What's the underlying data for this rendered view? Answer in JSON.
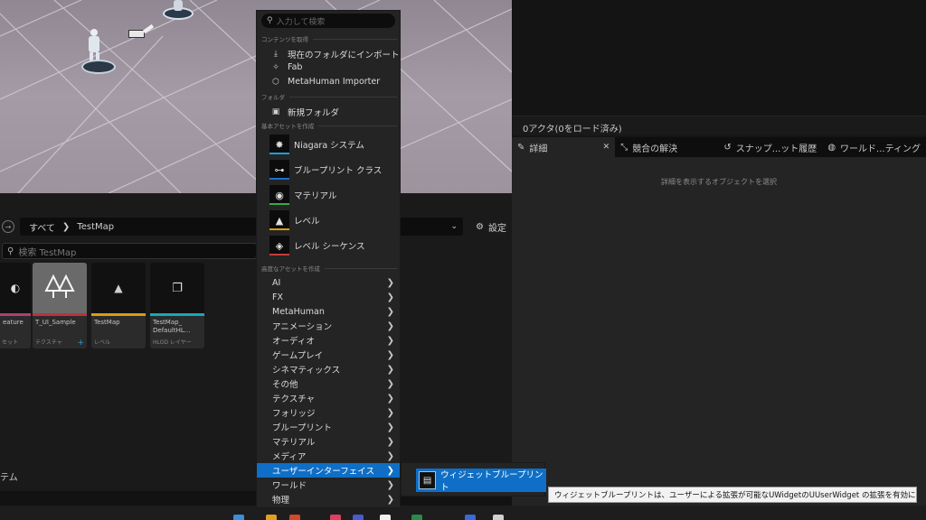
{
  "viewport": {},
  "right_panel": {
    "outliner_status": "0アクタ(0をロード済み)",
    "tabs": [
      {
        "label": "詳細",
        "icon": "pencil-icon",
        "closable": true
      },
      {
        "label": "競合の解決",
        "icon": "merge-icon"
      },
      {
        "label": "スナップ...ット履歴",
        "icon": "history-icon"
      },
      {
        "label": "ワールド...ティング",
        "icon": "globe-icon"
      }
    ],
    "close_glyph": "✕",
    "details_empty_text": "詳細を表示するオブジェクトを選択"
  },
  "content_browser": {
    "breadcrumb_root": "すべて",
    "breadcrumb_sep": "❯",
    "breadcrumb_current": "TestMap",
    "settings_label": "設定",
    "search_placeholder": "検索 TestMap",
    "assets": [
      {
        "name": "eature",
        "type": "セット",
        "color": "#b04070"
      },
      {
        "name": "T_UI_Sample",
        "type": "テクスチャ",
        "color": "#c0303c",
        "plus": "+"
      },
      {
        "name": "TestMap",
        "type": "レベル",
        "color": "#e09a10"
      },
      {
        "name": "TestMap_ DefaultHL...",
        "type": "HLOD レイヤー",
        "color": "#18a8b8"
      }
    ],
    "bottom_label": "テム"
  },
  "menu": {
    "search_placeholder": "入力して検索",
    "section_import": "コンテンツを取得",
    "import_items": [
      {
        "label": "現在のフォルダにインポート",
        "icon": "import-icon"
      },
      {
        "label": "Fab",
        "icon": "fab-icon"
      },
      {
        "label": "MetaHuman Importer",
        "icon": "cube-icon"
      }
    ],
    "section_folder": "フォルダ",
    "folder_items": [
      {
        "label": "新規フォルダ",
        "icon": "new-folder-icon"
      }
    ],
    "section_basic": "基本アセットを作成",
    "basic_assets": [
      {
        "label": "Niagara システム",
        "icon": "niagara-icon",
        "color": "#1aa0d8"
      },
      {
        "label": "ブループリント クラス",
        "icon": "blueprint-icon",
        "color": "#1b6fd0"
      },
      {
        "label": "マテリアル",
        "icon": "material-icon",
        "color": "#3aa84a"
      },
      {
        "label": "レベル",
        "icon": "level-icon",
        "color": "#e09a10"
      },
      {
        "label": "レベル シーケンス",
        "icon": "sequence-icon",
        "color": "#c83a3a"
      }
    ],
    "section_advanced": "高度なアセットを作成",
    "categories": [
      "AI",
      "FX",
      "MetaHuman",
      "アニメーション",
      "オーディオ",
      "ゲームプレイ",
      "シネマティックス",
      "その他",
      "テクスチャ",
      "フォリッジ",
      "ブループリント",
      "マテリアル",
      "メディア",
      "ユーザーインターフェイス",
      "ワールド",
      "物理"
    ],
    "highlighted_category": "ユーザーインターフェイス",
    "chevron": "❯"
  },
  "submenu": {
    "item_label": "ウィジェットブループリント",
    "icon": "widget-blueprint-icon"
  },
  "tooltip": {
    "text": "ウィジェットブループリントは、ユーザーによる拡張が可能なUWidgetのUUserWidget の拡張を有効にします"
  }
}
